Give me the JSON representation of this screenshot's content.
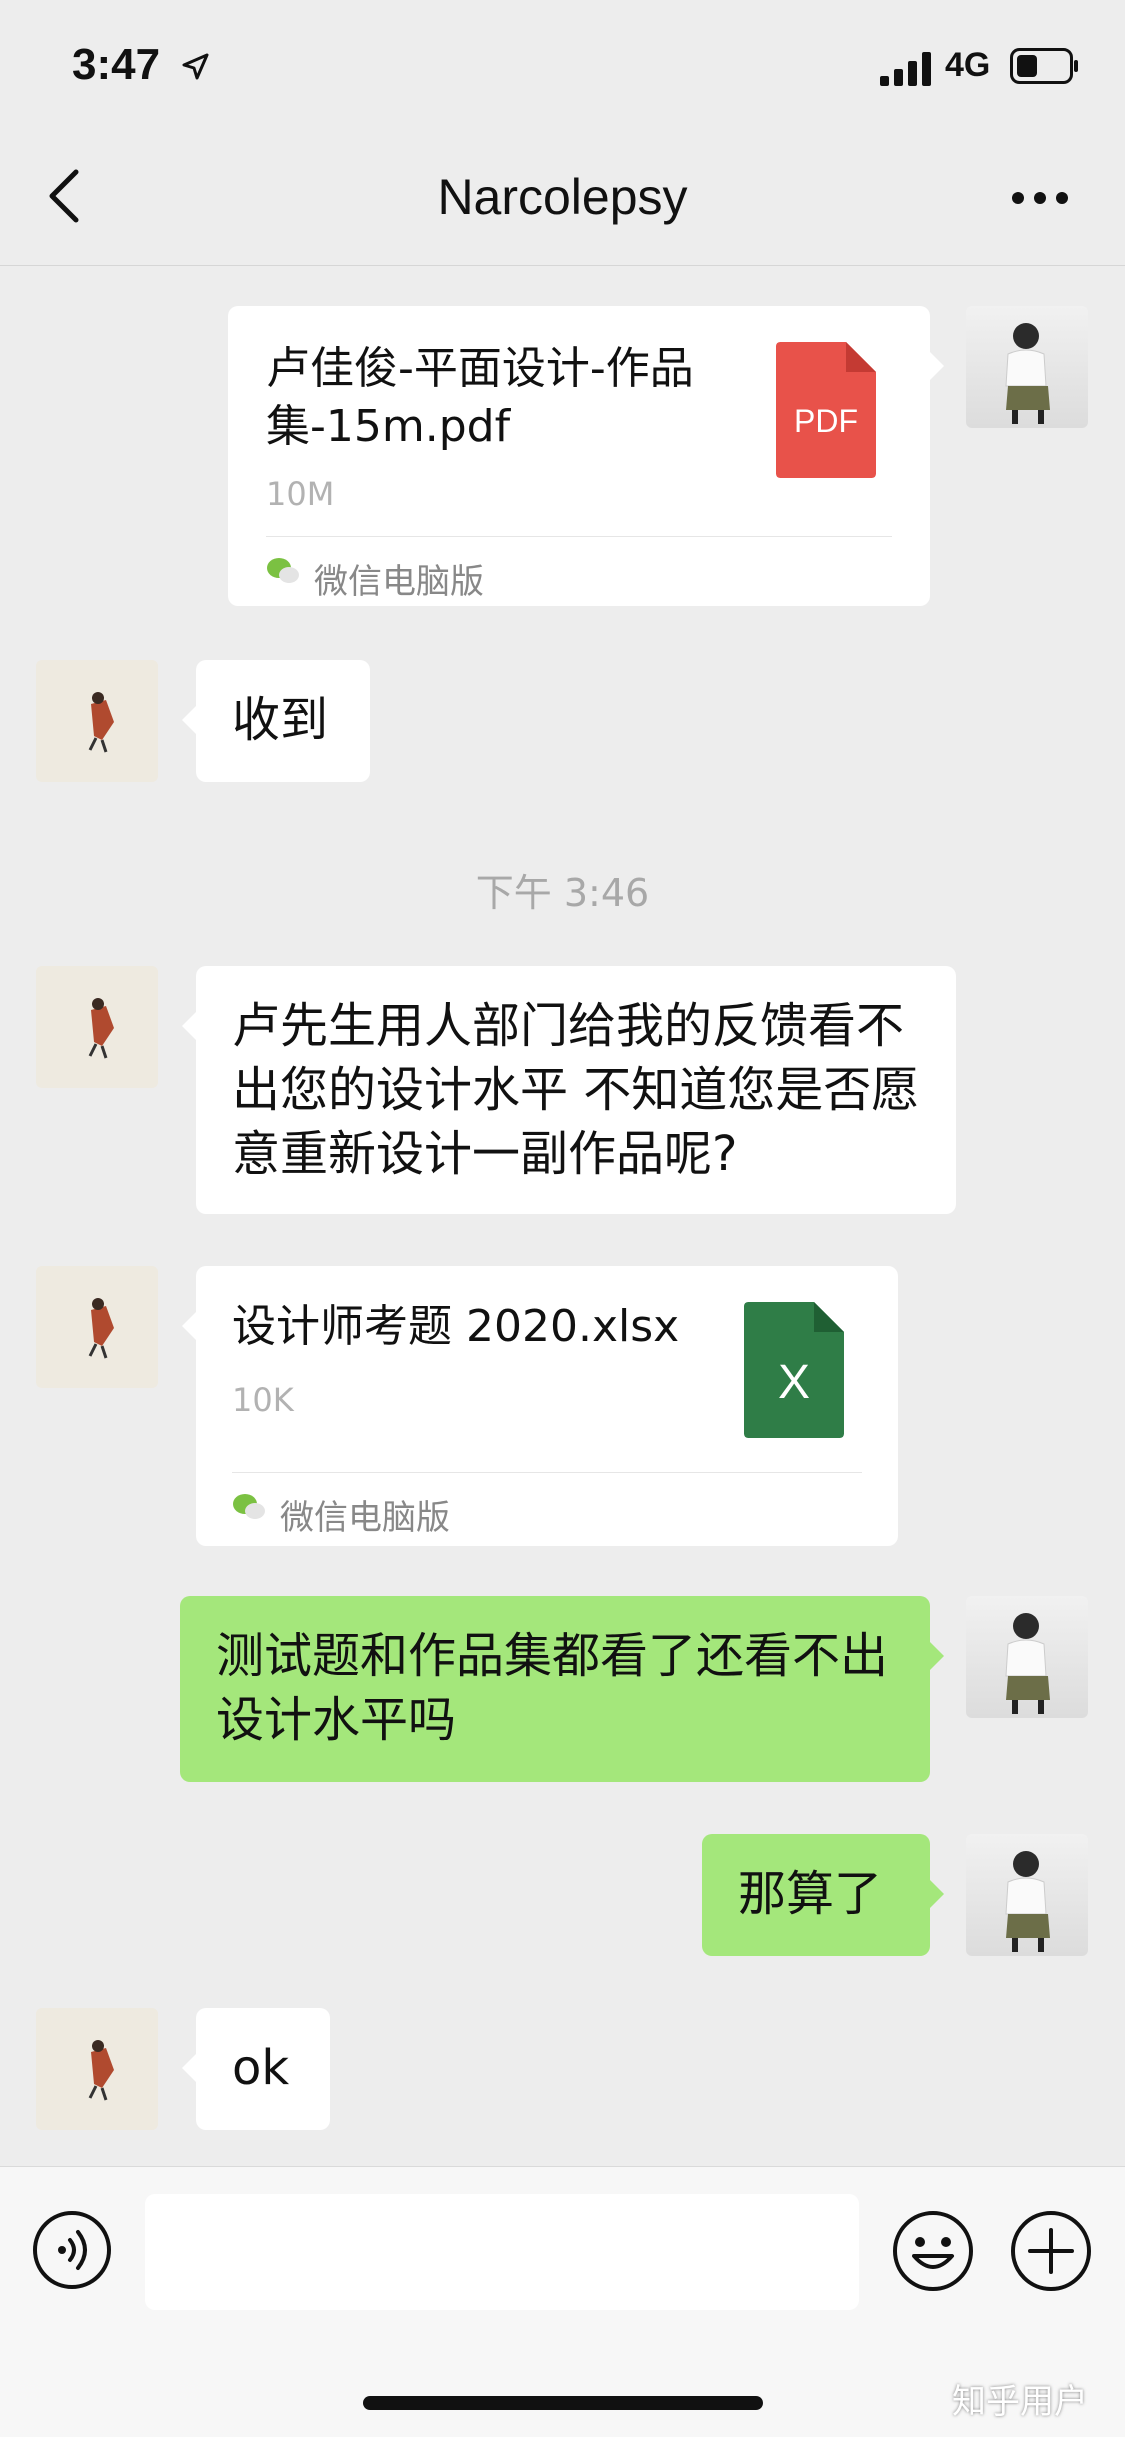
{
  "status": {
    "time": "3:47",
    "network": "4G"
  },
  "header": {
    "title": "Narcolepsy"
  },
  "messages": {
    "m1": {
      "file_name": "卢佳俊-平面设计-作品集-15m.pdf",
      "file_size": "10M",
      "source": "微信电脑版",
      "file_type": "PDF"
    },
    "m2": {
      "text": "收到"
    },
    "time1": "下午 3:46",
    "m3": {
      "text": "卢先生用人部门给我的反馈看不出您的设计水平 不知道您是否愿意重新设计一副作品呢?"
    },
    "m4": {
      "file_name": "设计师考题 2020.xlsx",
      "file_size": "10K",
      "source": "微信电脑版",
      "file_type": "X"
    },
    "m5": {
      "text": "测试题和作品集都看了还看不出设计水平吗"
    },
    "m6": {
      "text": "那算了"
    },
    "m7": {
      "text": "ok"
    }
  },
  "input": {
    "placeholder": ""
  },
  "watermark": "知乎用户",
  "colors": {
    "pdf_red": "#e8524a",
    "excel_green": "#2f7d47",
    "bubble_green": "#a4e77b",
    "background": "#ededed"
  },
  "icons": [
    "location-arrow-icon",
    "signal-icon",
    "battery-icon",
    "back-chevron-icon",
    "more-dots-icon",
    "pdf-file-icon",
    "excel-file-icon",
    "wechat-icon",
    "voice-icon",
    "emoji-icon",
    "plus-icon"
  ]
}
